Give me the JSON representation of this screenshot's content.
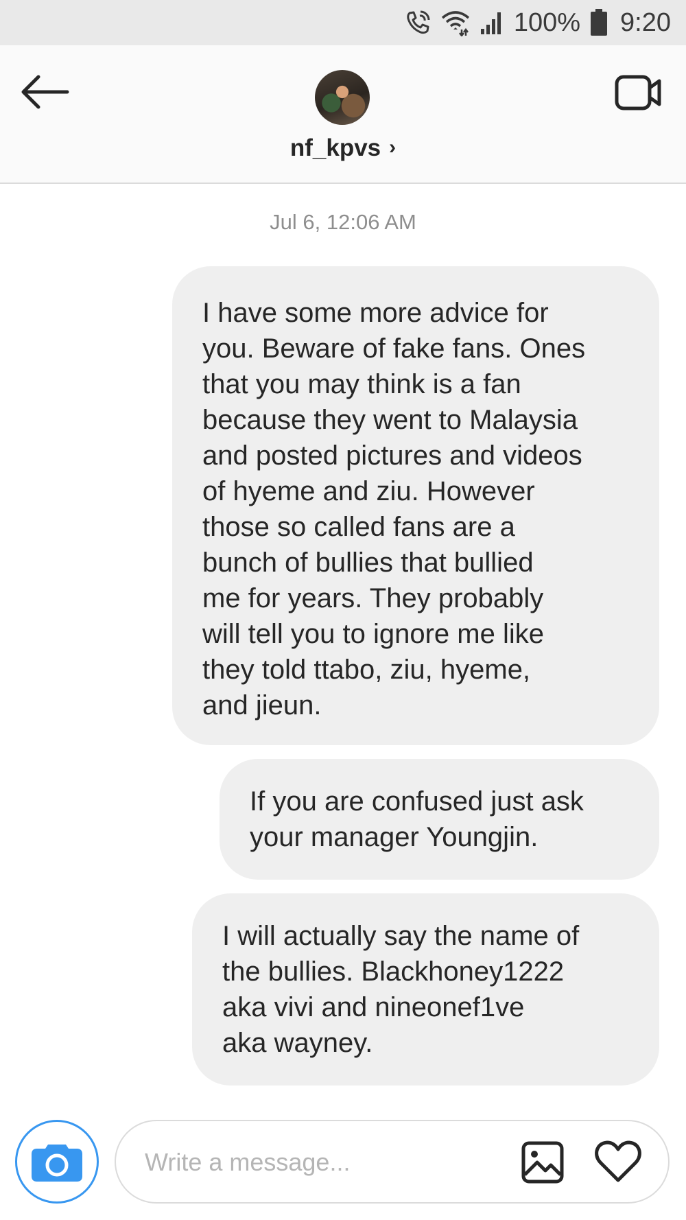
{
  "status_bar": {
    "battery": "100%",
    "time": "9:20",
    "icons": [
      "wifi-calling-icon",
      "wifi-icon",
      "signal-icon",
      "battery-icon"
    ]
  },
  "header": {
    "username": "nf_kpvs",
    "chevron": "›",
    "icons": [
      "back-arrow-icon",
      "avatar",
      "video-call-icon"
    ]
  },
  "thread": {
    "timestamp": "Jul 6, 12:06 AM",
    "messages": [
      {
        "lines": [
          "I have some more advice for",
          "you. Beware of fake fans. Ones",
          "that you may think is a fan",
          "because they went to Malaysia",
          "and posted pictures and videos",
          "of hyeme and ziu. However",
          "those so called fans are a",
          "bunch of bullies that bullied",
          "me for years. They probably",
          "will tell you to ignore me like",
          "they told ttabo, ziu, hyeme,",
          "and jieun."
        ]
      },
      {
        "lines": [
          "If you are confused just ask",
          "your manager Youngjin."
        ]
      },
      {
        "lines": [
          "I will actually say the name of",
          "the bullies. Blackhoney1222",
          "aka vivi and nineonef1ve",
          "aka wayney."
        ]
      }
    ]
  },
  "composer": {
    "placeholder": "Write a message...",
    "value": "",
    "icons": [
      "camera-icon",
      "gallery-icon",
      "heart-icon"
    ]
  },
  "colors": {
    "accent": "#3897f0",
    "bubble": "#efefef",
    "status_bar_bg": "#e9e9e9",
    "header_bg": "#fafafa",
    "timestamp": "#8e8e8e"
  }
}
